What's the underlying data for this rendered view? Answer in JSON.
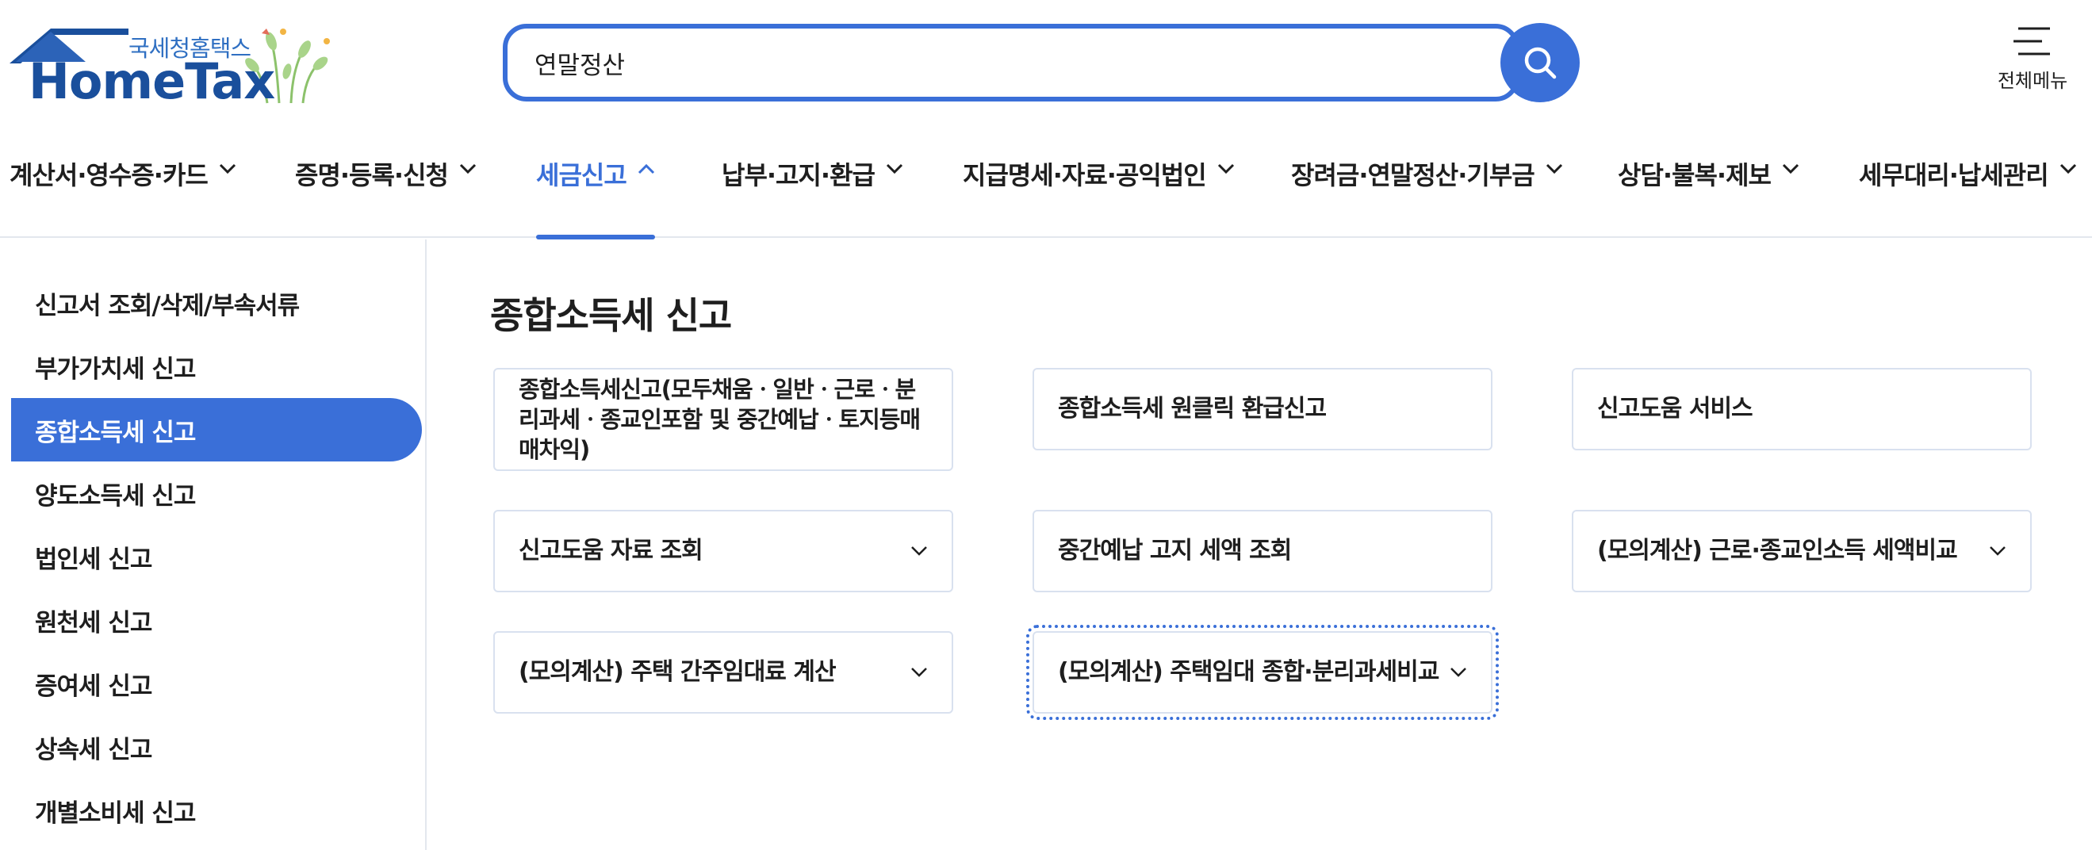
{
  "header": {
    "logo_sub": "국세청홈택스",
    "logo_main": "HomeTax",
    "search": {
      "value": "연말정산",
      "placeholder": ""
    },
    "menu_all_label": "전체메뉴"
  },
  "nav": {
    "items": [
      {
        "label": "계산서·영수증·카드",
        "active": false
      },
      {
        "label": "증명·등록·신청",
        "active": false
      },
      {
        "label": "세금신고",
        "active": true
      },
      {
        "label": "납부·고지·환급",
        "active": false
      },
      {
        "label": "지급명세·자료·공익법인",
        "active": false
      },
      {
        "label": "장려금·연말정산·기부금",
        "active": false
      },
      {
        "label": "상담·불복·제보",
        "active": false
      },
      {
        "label": "세무대리·납세관리",
        "active": false
      }
    ]
  },
  "sidebar": {
    "items": [
      {
        "label": "신고서 조회/삭제/부속서류"
      },
      {
        "label": "부가가치세 신고"
      },
      {
        "label": "종합소득세 신고"
      },
      {
        "label": "양도소득세 신고"
      },
      {
        "label": "법인세 신고"
      },
      {
        "label": "원천세 신고"
      },
      {
        "label": "증여세 신고"
      },
      {
        "label": "상속세 신고"
      },
      {
        "label": "개별소비세 신고"
      }
    ],
    "active_index": 2
  },
  "main": {
    "title": "종합소득세 신고",
    "cards": [
      {
        "label": "종합소득세신고(모두채움ㆍ일반ㆍ근로ㆍ분리과세ㆍ종교인포함 및 중간예납ㆍ토지등매매차익)",
        "expandable": false
      },
      {
        "label": "종합소득세 원클릭 환급신고",
        "expandable": false
      },
      {
        "label": "신고도움 서비스",
        "expandable": false
      },
      {
        "label": "신고도움 자료 조회",
        "expandable": true
      },
      {
        "label": "중간예납 고지 세액 조회",
        "expandable": false
      },
      {
        "label": "(모의계산) 근로·종교인소득 세액비교",
        "expandable": true
      },
      {
        "label": "(모의계산) 주택 간주임대료 계산",
        "expandable": true
      },
      {
        "label": "(모의계산) 주택임대 종합·분리과세비교",
        "expandable": true
      }
    ]
  },
  "colors": {
    "accent": "#3a6fd8",
    "logo_blue": "#1a4f9c",
    "border": "#d9e1ef",
    "text": "#1e1e1e"
  }
}
